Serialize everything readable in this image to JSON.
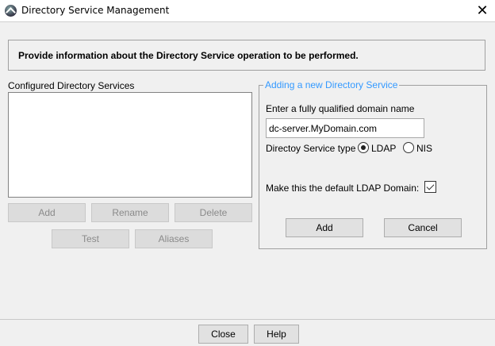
{
  "window": {
    "title": "Directory Service Management",
    "close_glyph": "✕"
  },
  "info": "Provide information about the Directory Service operation to be performed.",
  "configured": {
    "label": "Configured Directory Services",
    "items": [],
    "buttons": {
      "add": "Add",
      "rename": "Rename",
      "delete": "Delete",
      "test": "Test",
      "aliases": "Aliases"
    }
  },
  "new_service": {
    "legend": "Adding a new Directory Service",
    "domain_label": "Enter a fully qualified domain name",
    "domain_value": "dc-server.MyDomain.com",
    "type_label": "Directoy Service type",
    "type_options": [
      "LDAP",
      "NIS"
    ],
    "selected_type": "LDAP",
    "default_label": "Make this the default LDAP Domain:",
    "default_checked": true,
    "add": "Add",
    "cancel": "Cancel"
  },
  "footer": {
    "close": "Close",
    "help": "Help"
  },
  "colors": {
    "legend": "#3399ff"
  }
}
